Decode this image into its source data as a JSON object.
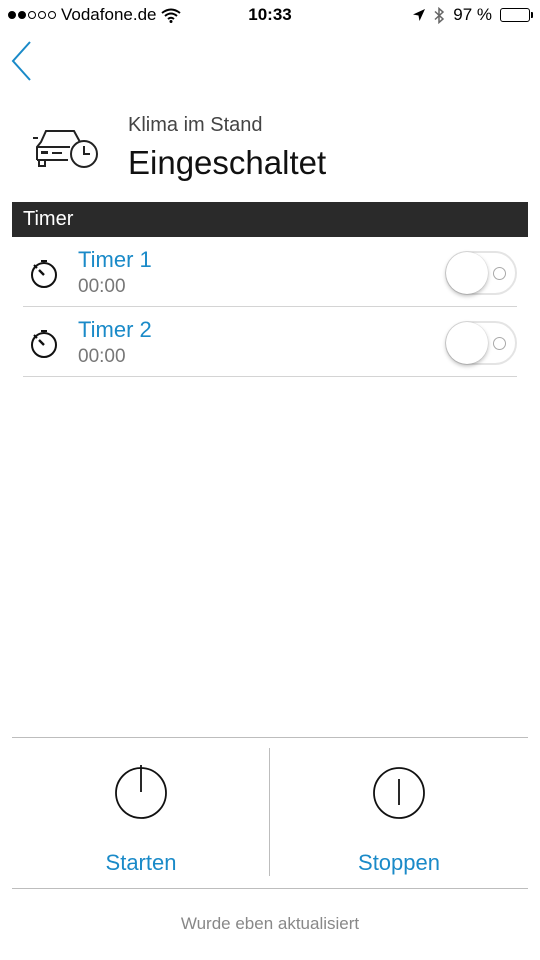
{
  "status_bar": {
    "carrier": "Vodafone.de",
    "time": "10:33",
    "battery": "97 %",
    "battery_level": 0.97
  },
  "header": {
    "subtitle": "Klima im Stand",
    "title": "Eingeschaltet"
  },
  "section": {
    "title": "Timer"
  },
  "timers": [
    {
      "name": "Timer 1",
      "time": "00:00",
      "enabled": false
    },
    {
      "name": "Timer 2",
      "time": "00:00",
      "enabled": false
    }
  ],
  "actions": {
    "start_label": "Starten",
    "stop_label": "Stoppen"
  },
  "footer": {
    "status": "Wurde eben aktualisiert"
  },
  "colors": {
    "accent": "#1a8ac8",
    "section_bar": "#2a2a2a",
    "muted_text": "#777777"
  },
  "icons": {
    "back": "chevron-left-icon",
    "header": "car-clock-icon",
    "timer": "stopwatch-icon",
    "start": "power-icon",
    "stop": "stop-icon"
  }
}
